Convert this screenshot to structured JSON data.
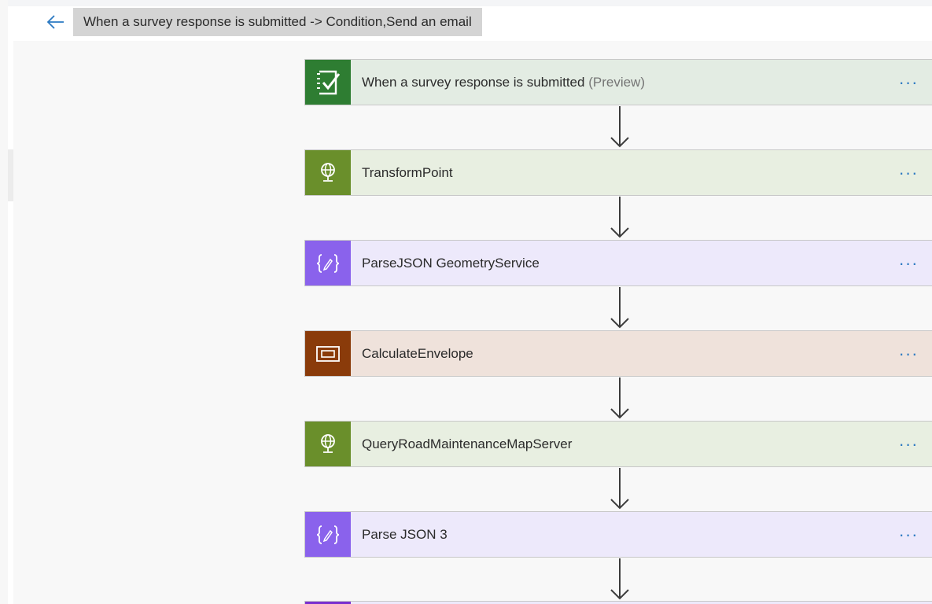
{
  "header": {
    "title": "When a survey response is submitted -> Condition,Send an email"
  },
  "steps": [
    {
      "title": "When a survey response is submitted",
      "suffix": "(Preview)",
      "more": "···"
    },
    {
      "title": "TransformPoint",
      "more": "···"
    },
    {
      "title": "ParseJSON GeometryService",
      "more": "···"
    },
    {
      "title": "CalculateEnvelope",
      "more": "···"
    },
    {
      "title": "QueryRoadMaintenanceMapServer",
      "more": "···"
    },
    {
      "title": "Parse JSON 3",
      "more": "···"
    }
  ],
  "colors": {
    "forms_icon": "#2e7d32",
    "forms_bg": "#e3ece3",
    "geo_icon": "#6a8f2b",
    "geo_bg": "#e8efe1",
    "json_icon": "#8a62ec",
    "json_bg": "#ede9fb",
    "envelope_icon": "#8a3b0a",
    "envelope_bg": "#efe2db",
    "accent": "#2b79c2"
  },
  "icons": {
    "back": "arrow-left-icon",
    "step_0": "forms-checklist-icon",
    "step_1": "globe-icon",
    "step_2": "json-braces-icon",
    "step_3": "envelope-rectangle-icon",
    "step_4": "globe-icon",
    "step_5": "json-braces-icon"
  }
}
